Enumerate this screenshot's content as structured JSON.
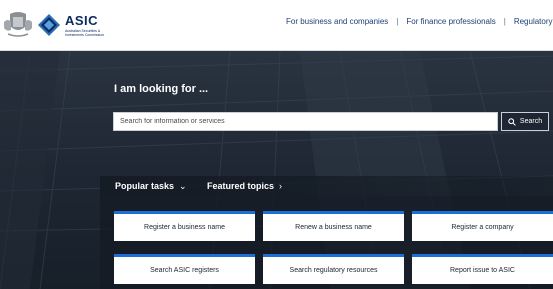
{
  "header": {
    "logo_word": "ASIC",
    "logo_sub": "Australian Securities & Investments Commission",
    "nav": [
      {
        "label": "For business and companies"
      },
      {
        "label": "For finance professionals"
      },
      {
        "label": "Regulatory resou"
      }
    ],
    "nav_separator": "|"
  },
  "hero": {
    "title": "I am looking for ...",
    "search": {
      "placeholder": "Search for information or services",
      "value": "",
      "button_label": "Search"
    }
  },
  "tabs": [
    {
      "label": "Popular tasks",
      "icon": "chevron-down-icon"
    },
    {
      "label": "Featured topics",
      "icon": "chevron-right-icon"
    }
  ],
  "tiles": [
    {
      "label": "Register a business name"
    },
    {
      "label": "Renew a business name"
    },
    {
      "label": "Register a company"
    },
    {
      "label": "Search ASIC registers"
    },
    {
      "label": "Search regulatory resources"
    },
    {
      "label": "Report issue to ASIC"
    }
  ],
  "colors": {
    "brand_navy": "#0c2c61",
    "tile_accent": "#1c6fd6",
    "hero_bg": "#1e2733"
  }
}
